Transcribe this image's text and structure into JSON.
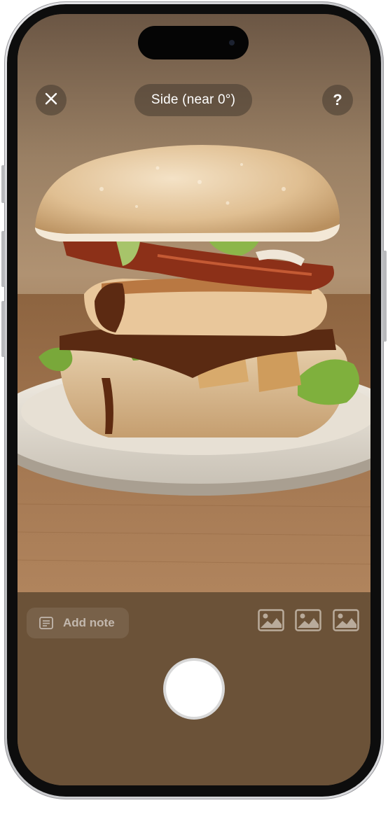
{
  "header": {
    "close_icon": "close-icon",
    "angle_label": "Side (near 0°)",
    "help_label": "?"
  },
  "capture_panel": {
    "add_note_label": "Add note",
    "note_icon": "note-icon",
    "thumbnails": [
      "image-placeholder-icon",
      "image-placeholder-icon",
      "image-placeholder-icon"
    ],
    "shutter_icon": "shutter-button"
  },
  "viewfinder": {
    "subject": "camera-preview"
  },
  "colors": {
    "panel": "#6b5238",
    "overlay": "#463a30",
    "accent_white": "#ffffff"
  }
}
